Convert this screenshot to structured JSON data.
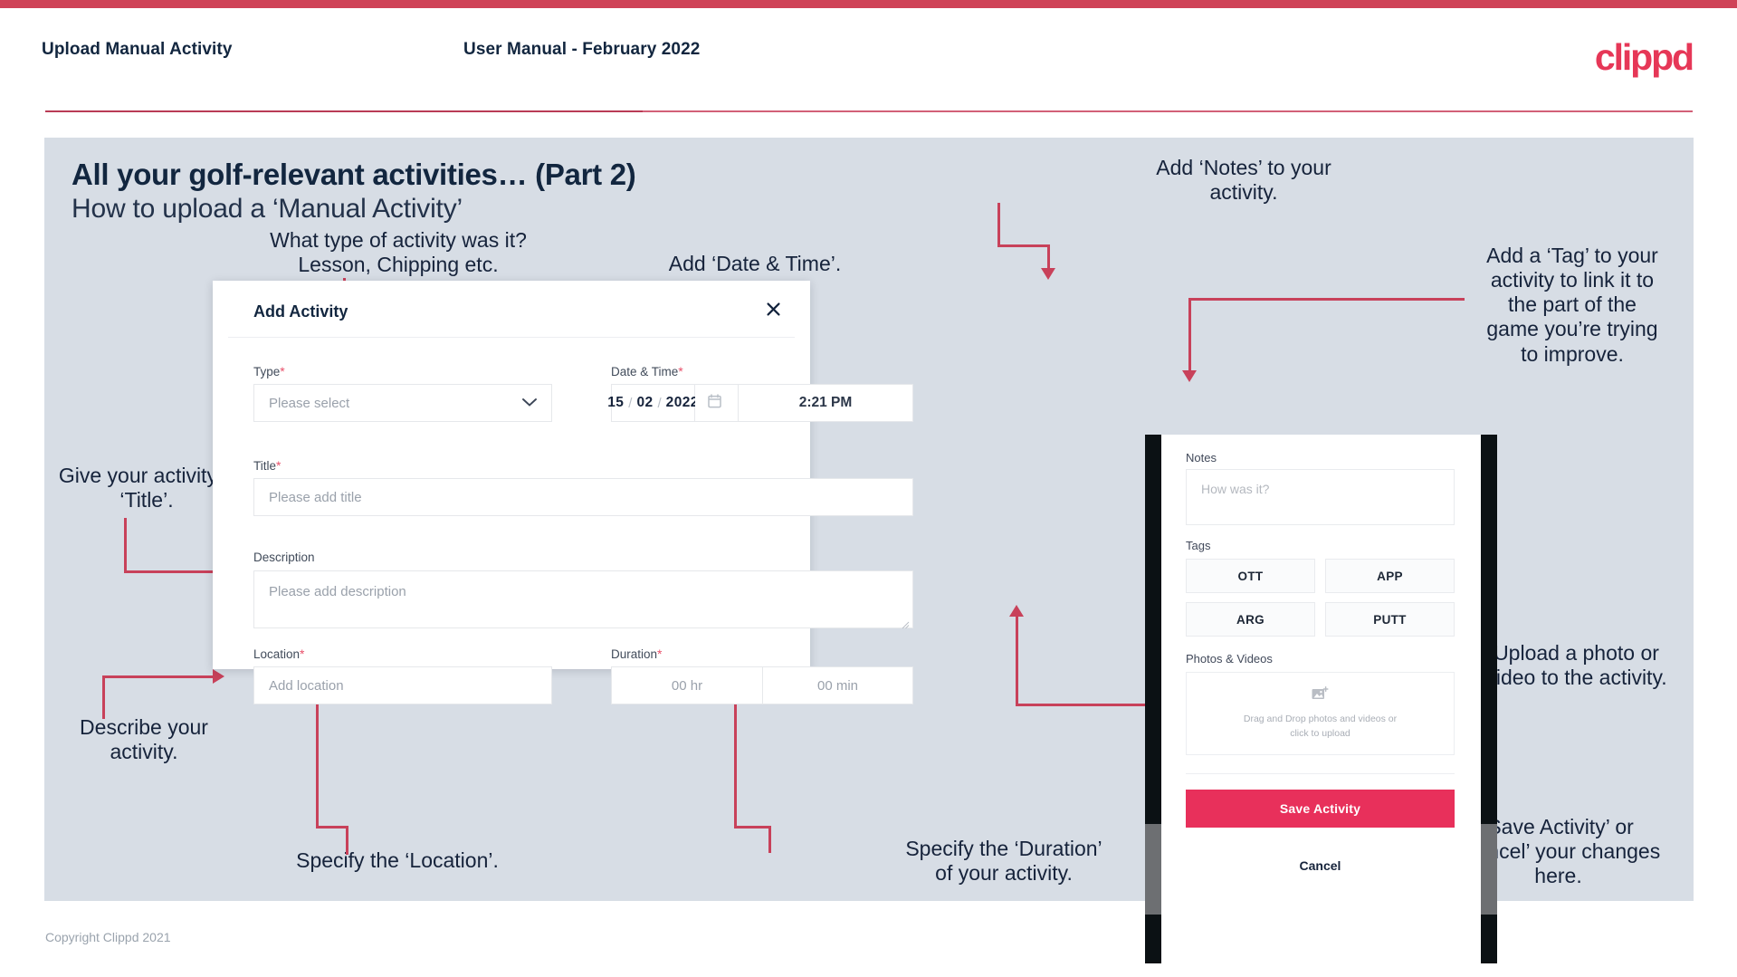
{
  "header": {
    "left_title": "Upload Manual Activity",
    "center_title": "User Manual - February 2022",
    "logo": "clippd"
  },
  "slide": {
    "title": "All your golf-relevant activities… (Part 2)",
    "subtitle": "How to upload a ‘Manual Activity’"
  },
  "callouts": {
    "type": "What type of activity was it?\nLesson, Chipping etc.",
    "datetime": "Add ‘Date & Time’.",
    "title": "Give your activity a\n‘Title’.",
    "description": "Describe your\nactivity.",
    "location": "Specify the ‘Location’.",
    "duration": "Specify the ‘Duration’\nof your activity.",
    "notes": "Add ‘Notes’ to your\nactivity.",
    "tag": "Add a ‘Tag’ to your\nactivity to link it to\nthe part of the\ngame you’re trying\nto improve.",
    "upload": "Upload a photo or\nvideo to the activity.",
    "save": "‘Save Activity’ or\n‘Cancel’ your changes\nhere."
  },
  "dialog": {
    "title": "Add Activity",
    "close_icon": "close-icon",
    "fields": {
      "type": {
        "label": "Type",
        "required": "*",
        "placeholder": "Please select",
        "icon": "chevron-down-icon"
      },
      "datetime": {
        "label": "Date & Time",
        "required": "*",
        "day": "15",
        "month": "02",
        "year": "2022",
        "separator": "/",
        "calendar_icon": "calendar-icon",
        "time": "2:21 PM"
      },
      "title": {
        "label": "Title",
        "required": "*",
        "placeholder": "Please add title"
      },
      "description": {
        "label": "Description",
        "required": "",
        "placeholder": "Please add description"
      },
      "location": {
        "label": "Location",
        "required": "*",
        "placeholder": "Add location"
      },
      "duration": {
        "label": "Duration",
        "required": "*",
        "hours_placeholder": "00 hr",
        "minutes_placeholder": "00 min"
      }
    }
  },
  "phone": {
    "notes": {
      "label": "Notes",
      "placeholder": "How was it?"
    },
    "tags": {
      "label": "Tags",
      "items": [
        "OTT",
        "APP",
        "ARG",
        "PUTT"
      ]
    },
    "photos": {
      "label": "Photos & Videos",
      "icon": "add-image-icon",
      "line1": "Drag and Drop photos and videos or",
      "line2": "click to upload"
    },
    "save_label": "Save Activity",
    "cancel_label": "Cancel"
  },
  "footer": {
    "copyright": "Copyright Clippd 2021"
  },
  "colors": {
    "brand": "#e8305b",
    "accent_bar": "#cf4257",
    "arrow": "#c8415a",
    "slide_bg": "#d7dde5",
    "text_dark": "#12263f"
  }
}
